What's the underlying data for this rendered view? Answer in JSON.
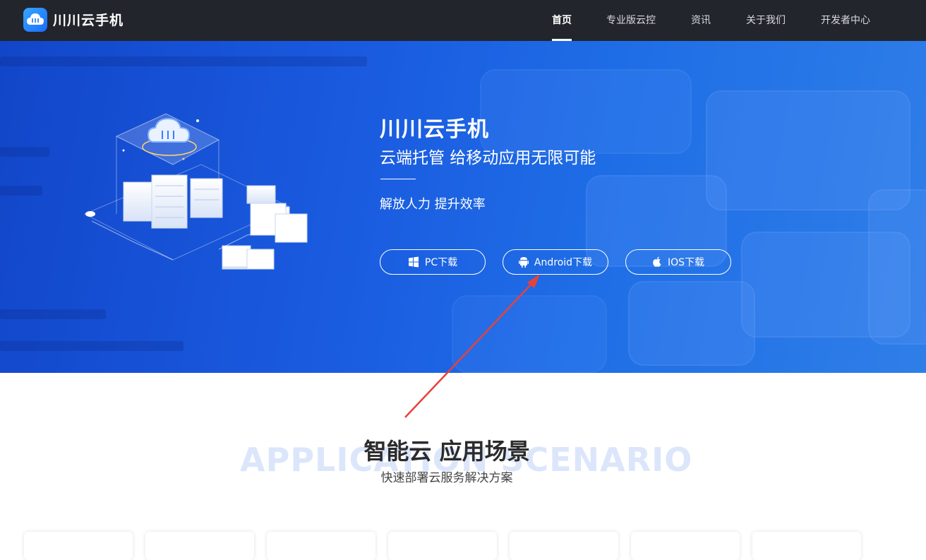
{
  "nav": {
    "brand": "川川云手机",
    "items": [
      {
        "label": "首页",
        "active": true
      },
      {
        "label": "专业版云控"
      },
      {
        "label": "资讯"
      },
      {
        "label": "关于我们"
      },
      {
        "label": "开发者中心"
      }
    ]
  },
  "hero": {
    "title": "川川云手机",
    "subtitle": "云端托管 给移动应用无限可能",
    "slogan": "解放人力 提升效率",
    "buttons": [
      {
        "label": "PC下载",
        "icon": "windows-icon"
      },
      {
        "label": "Android下载",
        "icon": "android-icon"
      },
      {
        "label": "IOS下载",
        "icon": "apple-icon"
      }
    ]
  },
  "scenario": {
    "title": "智能云 应用场景",
    "watermark": "APPLICATION SCENARIO",
    "subtitle": "快速部署云服务解决方案"
  },
  "colors": {
    "nav_bg": "#22252b",
    "hero_blue": "#1a5be0",
    "annotation_arrow": "#e8413a"
  }
}
